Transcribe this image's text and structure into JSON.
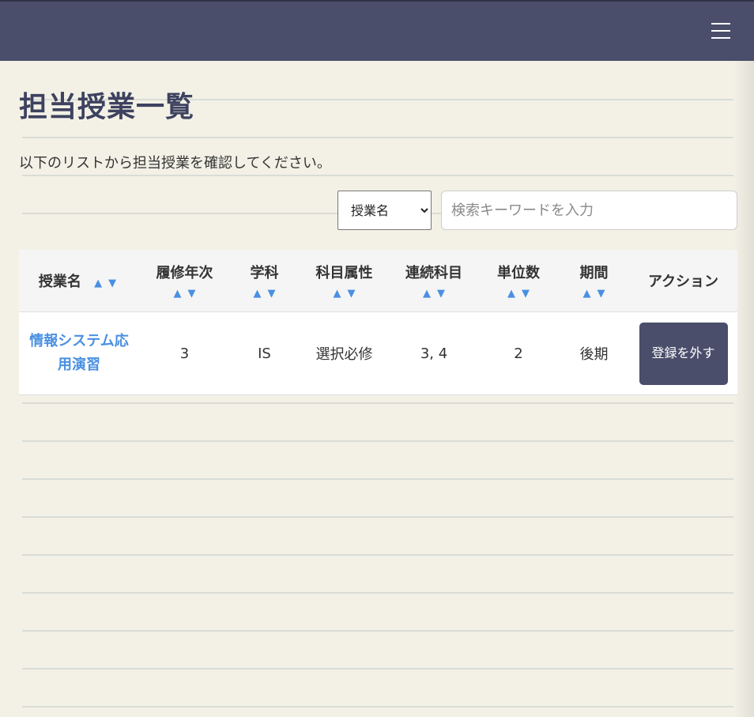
{
  "page": {
    "title": "担当授業一覧",
    "intro": "以下のリストから担当授業を確認してください。"
  },
  "colors": {
    "header_bg": "#4a4e6b",
    "accent": "#4a90e2",
    "paper_bg": "#f3f1e6"
  },
  "search": {
    "field_selected": "授業名",
    "placeholder": "検索キーワードを入力",
    "value": ""
  },
  "table": {
    "columns": [
      {
        "label": "授業名",
        "sortable": true
      },
      {
        "label": "履修年次",
        "sortable": true
      },
      {
        "label": "学科",
        "sortable": true
      },
      {
        "label": "科目属性",
        "sortable": true
      },
      {
        "label": "連続科目",
        "sortable": true
      },
      {
        "label": "単位数",
        "sortable": true
      },
      {
        "label": "期間",
        "sortable": true
      },
      {
        "label": "アクション",
        "sortable": false
      }
    ],
    "sort_up": "▲",
    "sort_down": "▼",
    "rows": [
      {
        "course_name": "情報システム応用演習",
        "year": "3",
        "department": "IS",
        "attribute": "選択必修",
        "continuous": "3, 4",
        "credits": "2",
        "term": "後期",
        "action_label": "登録を外す"
      }
    ]
  }
}
